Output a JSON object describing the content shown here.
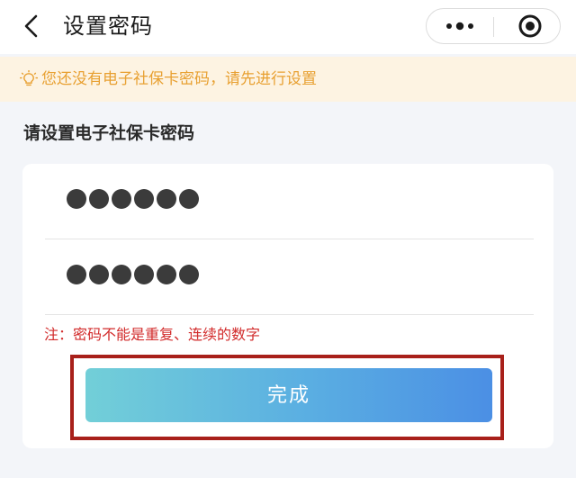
{
  "nav": {
    "title": "设置密码"
  },
  "notice": {
    "text": "您还没有电子社保卡密码，请先进行设置"
  },
  "form": {
    "section_title": "请设置电子社保卡密码",
    "password_dots": 6,
    "confirm_dots": 6,
    "note": "注：密码不能是重复、连续的数字",
    "submit_label": "完成"
  },
  "colors": {
    "notice_bg": "#fdf3e2",
    "notice_text": "#e8a031",
    "note_text": "#d22b2b",
    "button_gradient_start": "#72cfd8",
    "button_gradient_end": "#4b8fe4",
    "highlight_border": "#a8201a"
  },
  "icons": {
    "back": "chevron-left-icon",
    "more": "more-dots-icon",
    "close": "target-circle-icon",
    "bulb": "lightbulb-icon"
  }
}
